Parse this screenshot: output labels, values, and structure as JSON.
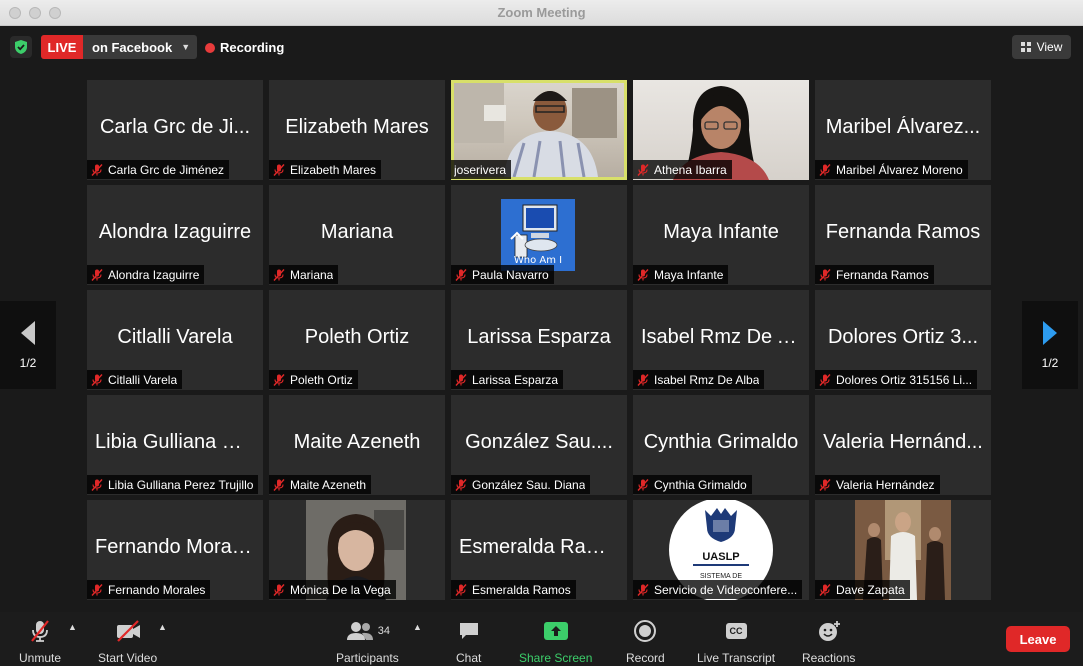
{
  "window": {
    "title": "Zoom Meeting"
  },
  "topbar": {
    "live_label": "LIVE",
    "live_destination": "on Facebook",
    "recording_label": "Recording",
    "view_label": "View"
  },
  "pagination": {
    "left": "1/2",
    "right": "1/2"
  },
  "tiles": [
    {
      "display": "Carla Grc de Ji...",
      "name": "Carla Grc de Jiménez"
    },
    {
      "display": "Elizabeth Mares",
      "name": "Elizabeth Mares"
    },
    {
      "display": "",
      "name": "joserivera"
    },
    {
      "display": "",
      "name": "Athena Ibarra"
    },
    {
      "display": "Maribel Álvarez...",
      "name": "Maribel Álvarez Moreno"
    },
    {
      "display": "Alondra Izaguirre",
      "name": "Alondra Izaguirre"
    },
    {
      "display": "Mariana",
      "name": "Mariana"
    },
    {
      "display": "",
      "name": "Paula Navarro",
      "overlay": "Who Am I"
    },
    {
      "display": "Maya Infante",
      "name": "Maya Infante"
    },
    {
      "display": "Fernanda Ramos",
      "name": "Fernanda Ramos"
    },
    {
      "display": "Citlalli Varela",
      "name": "Citlalli Varela"
    },
    {
      "display": "Poleth Ortiz",
      "name": "Poleth Ortiz"
    },
    {
      "display": "Larissa Esparza",
      "name": "Larissa Esparza"
    },
    {
      "display": "Isabel Rmz De A...",
      "name": "Isabel Rmz De Alba"
    },
    {
      "display": "Dolores Ortiz  3...",
      "name": "Dolores Ortiz  315156 Li..."
    },
    {
      "display": "Libia Gulliana Pe...",
      "name": "Libia Gulliana Perez Trujillo"
    },
    {
      "display": "Maite Azeneth",
      "name": "Maite Azeneth"
    },
    {
      "display": "González Sau....",
      "name": "González Sau. Diana"
    },
    {
      "display": "Cynthia Grimaldo",
      "name": "Cynthia Grimaldo"
    },
    {
      "display": "Valeria Hernánd...",
      "name": "Valeria Hernández"
    },
    {
      "display": "Fernando Morales",
      "name": "Fernando Morales"
    },
    {
      "display": "",
      "name": "Mónica De la Vega"
    },
    {
      "display": "Esmeralda Ramos",
      "name": "Esmeralda Ramos"
    },
    {
      "display": "",
      "name": "Servicio de Videoconfere...",
      "logo_text": "UASLP",
      "logo_sub": "SISTEMA DE"
    },
    {
      "display": "",
      "name": "Dave Zapata"
    }
  ],
  "toolbar": {
    "unmute": "Unmute",
    "start_video": "Start Video",
    "participants": "Participants",
    "participants_count": "34",
    "chat": "Chat",
    "share_screen": "Share Screen",
    "record": "Record",
    "live_transcript": "Live Transcript",
    "cc": "CC",
    "reactions": "Reactions",
    "leave": "Leave"
  },
  "colors": {
    "live": "#e02828",
    "share": "#3cce6a",
    "active_speaker": "#d8e06a",
    "leave": "#e02828"
  }
}
